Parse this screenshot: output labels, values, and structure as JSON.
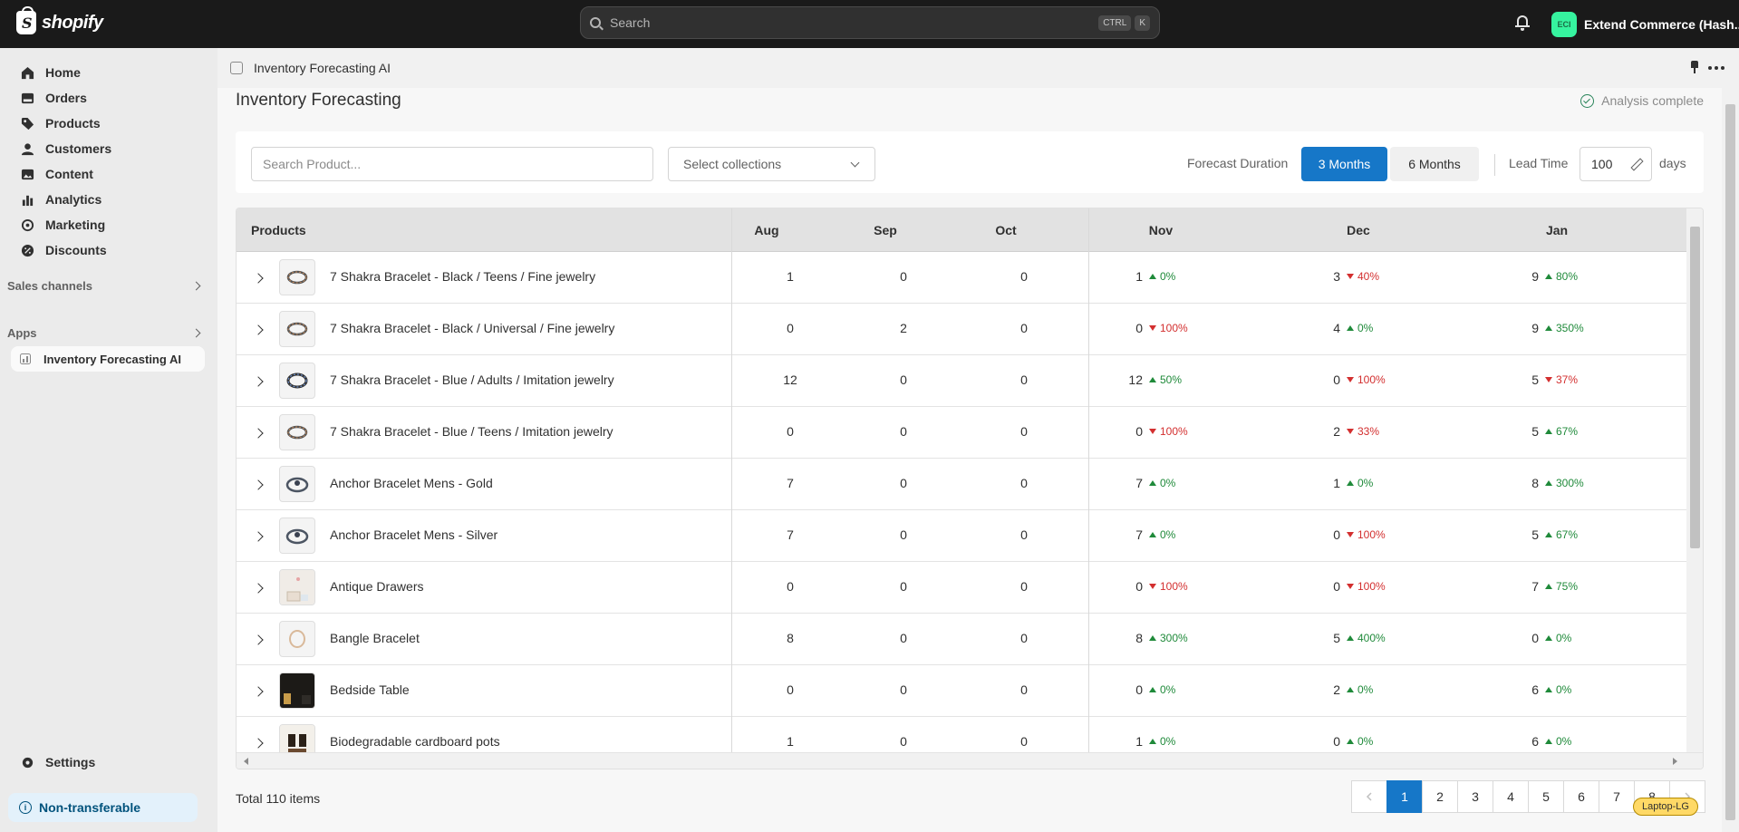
{
  "topbar": {
    "logo_text": "shopify",
    "logo_glyph": "S",
    "search_placeholder": "Search",
    "shortcut_ctrl": "CTRL",
    "shortcut_k": "K",
    "store_initials": "ECI",
    "store_name": "Extend Commerce (Hash...",
    "badge_color": "#36f39f"
  },
  "sidebar": {
    "items": [
      {
        "label": "Home",
        "icon": "home-icon"
      },
      {
        "label": "Orders",
        "icon": "orders-icon"
      },
      {
        "label": "Products",
        "icon": "tag-icon"
      },
      {
        "label": "Customers",
        "icon": "person-icon"
      },
      {
        "label": "Content",
        "icon": "content-icon"
      },
      {
        "label": "Analytics",
        "icon": "chart-icon"
      },
      {
        "label": "Marketing",
        "icon": "target-icon"
      },
      {
        "label": "Discounts",
        "icon": "discount-icon"
      }
    ],
    "sales_channels": "Sales channels",
    "apps": "Apps",
    "app_item": "Inventory Forecasting AI",
    "settings": "Settings",
    "non_transferable": "Non-transferable"
  },
  "app_header": {
    "title": "Inventory Forecasting AI"
  },
  "page": {
    "title": "Inventory Forecasting",
    "status": "Analysis complete",
    "search_placeholder": "Search Product...",
    "collections_placeholder": "Select collections",
    "forecast_duration_label": "Forecast Duration",
    "duration_options": [
      "3 Months",
      "6 Months"
    ],
    "selected_duration": "3 Months",
    "lead_time_label": "Lead Time",
    "lead_time_value": "100",
    "lead_time_unit": "days",
    "accent_color": "#1677c8"
  },
  "table": {
    "headers": {
      "products": "Products",
      "aug": "Aug",
      "sep": "Sep",
      "oct": "Oct",
      "nov": "Nov",
      "dec": "Dec",
      "jan": "Jan"
    },
    "rows": [
      {
        "name": "7 Shakra Bracelet - Black / Teens / Fine jewelry",
        "aug": "1",
        "sep": "0",
        "oct": "0",
        "nov": "1",
        "nov_pct": "0%",
        "nov_dir": "up",
        "dec": "3",
        "dec_pct": "40%",
        "dec_dir": "down",
        "jan": "9",
        "jan_pct": "80%",
        "jan_dir": "up"
      },
      {
        "name": "7 Shakra Bracelet - Black / Universal / Fine jewelry",
        "aug": "0",
        "sep": "2",
        "oct": "0",
        "nov": "0",
        "nov_pct": "100%",
        "nov_dir": "down",
        "dec": "4",
        "dec_pct": "0%",
        "dec_dir": "up",
        "jan": "9",
        "jan_pct": "350%",
        "jan_dir": "up"
      },
      {
        "name": "7 Shakra Bracelet - Blue / Adults / Imitation jewelry",
        "aug": "12",
        "sep": "0",
        "oct": "0",
        "nov": "12",
        "nov_pct": "50%",
        "nov_dir": "up",
        "dec": "0",
        "dec_pct": "100%",
        "dec_dir": "down",
        "jan": "5",
        "jan_pct": "37%",
        "jan_dir": "down"
      },
      {
        "name": "7 Shakra Bracelet - Blue / Teens / Imitation jewelry",
        "aug": "0",
        "sep": "0",
        "oct": "0",
        "nov": "0",
        "nov_pct": "100%",
        "nov_dir": "down",
        "dec": "2",
        "dec_pct": "33%",
        "dec_dir": "down",
        "jan": "5",
        "jan_pct": "67%",
        "jan_dir": "up"
      },
      {
        "name": "Anchor Bracelet Mens - Gold",
        "aug": "7",
        "sep": "0",
        "oct": "0",
        "nov": "7",
        "nov_pct": "0%",
        "nov_dir": "up",
        "dec": "1",
        "dec_pct": "0%",
        "dec_dir": "up",
        "jan": "8",
        "jan_pct": "300%",
        "jan_dir": "up"
      },
      {
        "name": "Anchor Bracelet Mens - Silver",
        "aug": "7",
        "sep": "0",
        "oct": "0",
        "nov": "7",
        "nov_pct": "0%",
        "nov_dir": "up",
        "dec": "0",
        "dec_pct": "100%",
        "dec_dir": "down",
        "jan": "5",
        "jan_pct": "67%",
        "jan_dir": "up"
      },
      {
        "name": "Antique Drawers",
        "aug": "0",
        "sep": "0",
        "oct": "0",
        "nov": "0",
        "nov_pct": "100%",
        "nov_dir": "down",
        "dec": "0",
        "dec_pct": "100%",
        "dec_dir": "down",
        "jan": "7",
        "jan_pct": "75%",
        "jan_dir": "up"
      },
      {
        "name": "Bangle Bracelet",
        "aug": "8",
        "sep": "0",
        "oct": "0",
        "nov": "8",
        "nov_pct": "300%",
        "nov_dir": "up",
        "dec": "5",
        "dec_pct": "400%",
        "dec_dir": "up",
        "jan": "0",
        "jan_pct": "0%",
        "jan_dir": "up"
      },
      {
        "name": "Bedside Table",
        "aug": "0",
        "sep": "0",
        "oct": "0",
        "nov": "0",
        "nov_pct": "0%",
        "nov_dir": "up",
        "dec": "2",
        "dec_pct": "0%",
        "dec_dir": "up",
        "jan": "6",
        "jan_pct": "0%",
        "jan_dir": "up"
      },
      {
        "name": "Biodegradable cardboard pots",
        "aug": "1",
        "sep": "0",
        "oct": "0",
        "nov": "1",
        "nov_pct": "0%",
        "nov_dir": "up",
        "dec": "0",
        "dec_pct": "0%",
        "dec_dir": "up",
        "jan": "6",
        "jan_pct": "0%",
        "jan_dir": "up"
      }
    ]
  },
  "footer": {
    "total": "Total 110 items",
    "pages": [
      "1",
      "2",
      "3",
      "4",
      "5",
      "6",
      "7",
      "8"
    ],
    "current_page": "1",
    "viewport_tag": "Laptop-LG"
  }
}
